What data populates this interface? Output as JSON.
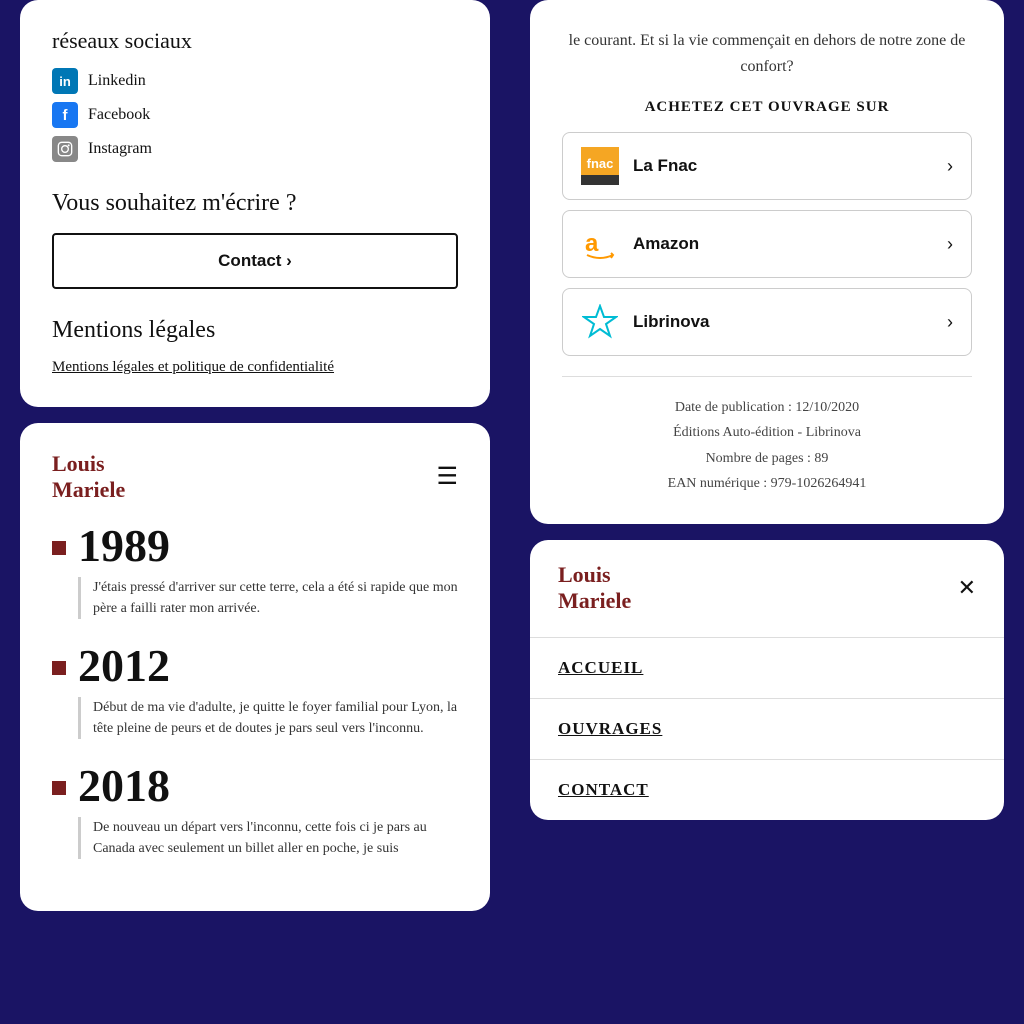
{
  "leftTopCard": {
    "socialTitle": "réseaux sociaux",
    "socialLinks": [
      {
        "name": "Linkedin",
        "icon": "in"
      },
      {
        "name": "Facebook",
        "icon": "f"
      },
      {
        "name": "Instagram",
        "icon": "📷"
      }
    ],
    "writeTitle": "Vous souhaitez m'écrire ?",
    "contactBtn": "Contact",
    "mentionsTitle": "Mentions légales",
    "mentionsLink": "Mentions légales et politique de confidentialité"
  },
  "leftBottomCard": {
    "brandLine1": "Louis",
    "brandLine2": "Mariele",
    "timeline": [
      {
        "year": "1989",
        "text": "J'étais pressé d'arriver sur cette terre, cela a été si rapide que mon père a failli rater mon arrivée."
      },
      {
        "year": "2012",
        "text": "Début de ma vie d'adulte, je quitte le foyer familial pour Lyon, la tête pleine de peurs et de doutes je pars seul vers l'inconnu."
      },
      {
        "year": "2018",
        "text": "De nouveau un départ vers l'inconnu, cette fois ci je pars au Canada avec seulement un billet aller en poche, je suis"
      }
    ]
  },
  "rightTopCard": {
    "introText": "le courant. Et si la vie commençait en dehors de notre zone de confort?",
    "buyTitle": "ACHETEZ CET OUVRAGE SUR",
    "stores": [
      {
        "name": "La Fnac"
      },
      {
        "name": "Amazon"
      },
      {
        "name": "Librinova"
      }
    ],
    "meta": {
      "publishDate": "Date de publication : 12/10/2020",
      "edition": "Éditions Auto-édition - Librinova",
      "pages": "Nombre de pages : 89",
      "ean": "EAN numérique : 979-1026264941"
    }
  },
  "rightBottomCard": {
    "brandLine1": "Louis",
    "brandLine2": "Mariele",
    "menuItems": [
      "ACCUEIL",
      "OUVRAGES",
      "CONTACT"
    ]
  }
}
